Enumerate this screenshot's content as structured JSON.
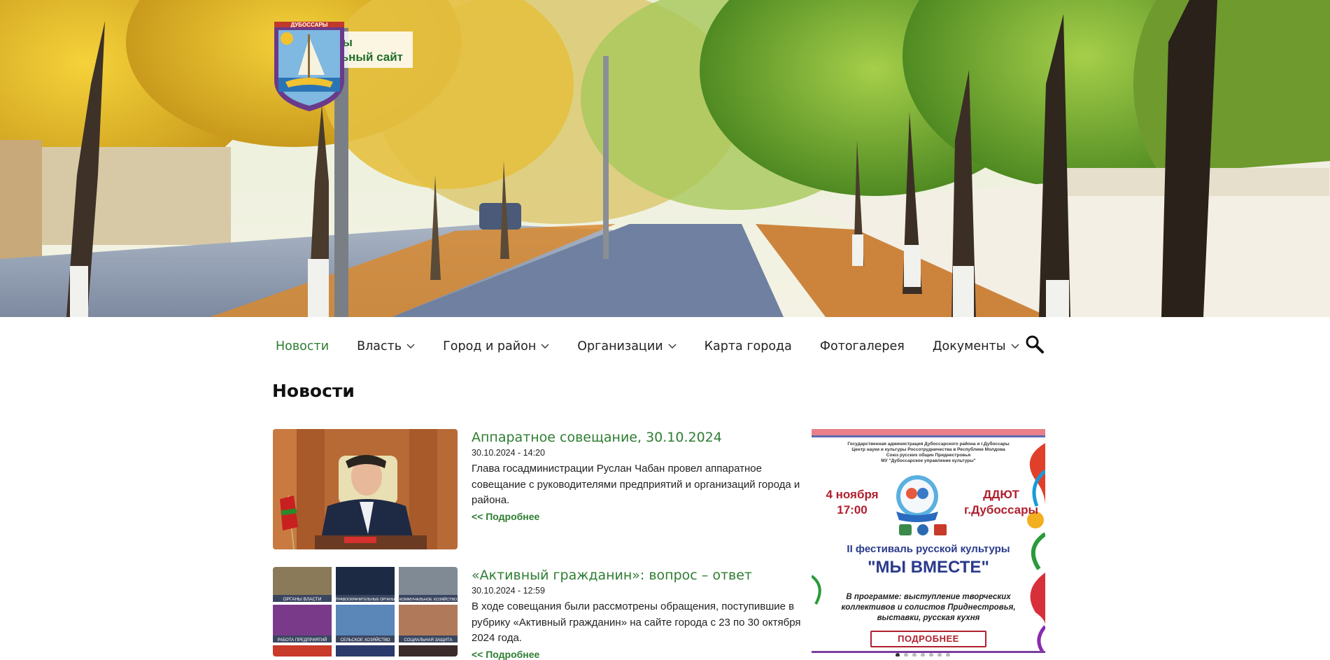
{
  "site": {
    "name_line1": "Дубоссары",
    "name_line2": "Официальный сайт",
    "crest_text": "ДУБОССАРЫ"
  },
  "nav": {
    "items": [
      {
        "label": "Новости",
        "active": true,
        "has_dropdown": false
      },
      {
        "label": "Власть",
        "active": false,
        "has_dropdown": true
      },
      {
        "label": "Город и район",
        "active": false,
        "has_dropdown": true
      },
      {
        "label": "Организации",
        "active": false,
        "has_dropdown": true
      },
      {
        "label": "Карта города",
        "active": false,
        "has_dropdown": false
      },
      {
        "label": "Фотогалерея",
        "active": false,
        "has_dropdown": false
      },
      {
        "label": "Документы",
        "active": false,
        "has_dropdown": true
      }
    ],
    "search_icon": "search-icon"
  },
  "page": {
    "title": "Новости"
  },
  "news": [
    {
      "title": "Аппаратное совещание, 30.10.2024",
      "date": "30.10.2024 - 14:20",
      "text": "Глава госадминистрации Руслан Чабан провел аппаратное совещание с руководителями предприятий и организаций города и района.",
      "more": "<< Подробнее"
    },
    {
      "title": "«Активный гражданин»: вопрос – ответ",
      "date": "30.10.2024 - 12:59",
      "text": "В ходе совещания были рассмотрены обращения, поступившие в рубрику «Активный гражданин» на сайте города с 23 по 30 октября 2024 года.",
      "more": "<< Подробнее",
      "tiles": [
        "ОРГАНЫ ВЛАСТИ",
        "ПРАВООХРАНИТЕЛЬНЫЕ ОРГАНЫ",
        "КОММУНАЛЬНОЕ ХОЗЯЙСТВО",
        "РАБОТА ПРЕДПРИЯТИЙ",
        "СЕЛЬСКОЕ ХОЗЯЙСТВО",
        "СОЦИАЛЬНАЯ ЗАЩИТА"
      ]
    }
  ],
  "banner": {
    "header": "Государственная администрация Дубоссарского района и г.Дубоссары\nЦентр науки и культуры Россотрудничества в Республике Молдова\nСоюз русских общин Приднестровья\nМУ \"Дубоссарское управление культуры\"",
    "date_line1": "4 ноября",
    "date_line2": "17:00",
    "place_line1": "ДДЮТ",
    "place_line2": "г.Дубоссары",
    "festival": "II фестиваль русской культуры",
    "name": "\"МЫ ВМЕСТЕ\"",
    "program": "В программе: выступление творческих коллективов и солистов Приднестровья, выставки, русская кухня",
    "button": "ПОДРОБНЕЕ",
    "slides_total": 7,
    "slide_active": 1
  }
}
